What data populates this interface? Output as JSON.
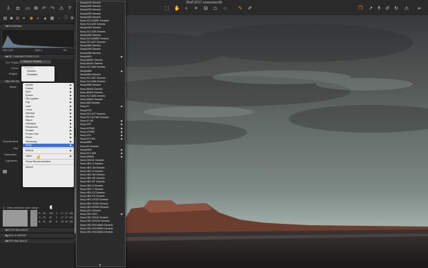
{
  "window": {
    "title": "Bluff 2017.cosessiondb"
  },
  "toolbar": {
    "left_icons": [
      "import-icon",
      "camera-icon",
      "folder-icon",
      "copy-icon",
      "undo-icon",
      "redo-icon",
      "warning-icon",
      "help-icon"
    ],
    "center_icons": [
      "cursor-tool-icon",
      "pan-tool-icon",
      "zoom-tool-icon",
      "crop-tool-icon",
      "straighten-tool-icon",
      "keystone-tool-icon",
      "spot-removal-icon",
      "brush-tool-icon",
      "picker-tool-icon"
    ],
    "right_icons": [
      "layers-icon",
      "copy-apply-icon",
      "reset-icon",
      "rotate-left-icon",
      "rotate-right-icon",
      "compare-icon",
      "glasses-icon"
    ]
  },
  "left_panel": {
    "histogram": {
      "title": "HISTOGRAM",
      "iso": "ISO 100",
      "shutter": "1/60 s",
      "aperture": "f/4"
    },
    "base_characteristics": {
      "title": "BASE CHARACTERISTICS",
      "icc_profile_label": "ICC Profile",
      "icc_profile_value": "Sony A7 Generic",
      "curve_label": "Curve",
      "engine_label": "Engine"
    },
    "section_ex": "COLOR ED",
    "basic_label": "Basic",
    "smoothness_label": "Smoothness",
    "hue_label": "Hue",
    "saturation_label": "Saturation",
    "lightness_label": "Lightness",
    "view_selected_label": "View selected color range",
    "readout": {
      "r_label": "R:",
      "g_label": "G:",
      "b_label": "B:",
      "cols": [
        [
          "95",
          "93",
          "91"
        ],
        [
          "102",
          "99",
          "96"
        ],
        [
          "4",
          "4",
          "5"
        ],
        [
          "17",
          "17",
          "18"
        ],
        [
          "17",
          "17",
          "18"
        ],
        [
          "184",
          "184",
          "184"
        ]
      ]
    },
    "color_balance": "COLOR BALANCE",
    "black_white": "BLACK & WHITE",
    "white_balance": "WHITE BALANCE"
  },
  "curve_menu": {
    "items": [
      {
        "label": "Sony A7",
        "disabled": true
      },
      {
        "label": "Generic",
        "disabled": false
      },
      {
        "label": "Standard",
        "disabled": false
      }
    ]
  },
  "make_menu": {
    "items": [
      "Adobe",
      "Canon",
      "DxO",
      "Epson",
      "File system",
      "Fuji",
      "Leaf",
      "Leica",
      "Mamiya",
      "Minolta",
      "Nikon",
      "Olympus",
      "Panasonic",
      "Pentax",
      "Phase One",
      "Ricoh",
      "Samsung",
      "Sony"
    ],
    "selected": "Sony",
    "footer": [
      "Effects",
      "Other",
      "Show Recommended",
      "Import"
    ]
  },
  "sony_menu": {
    "items": [
      {
        "label": "SonyA100 Generic",
        "sub": false
      },
      {
        "label": "SonyA200 Generic",
        "sub": false
      },
      {
        "label": "SonyA230 Generic",
        "sub": false
      },
      {
        "label": "SonyA290 Generic",
        "sub": false
      },
      {
        "label": "SonyA300 Generic",
        "sub": false
      },
      {
        "label": "Sony SLT-A33SR Generic",
        "sub": false
      },
      {
        "label": "Sony SLT-A33 Generic",
        "sub": false
      },
      {
        "label": "SonyA330 Generic",
        "sub": false
      },
      {
        "label": "Sony SLT-A35 Generic",
        "sub": false
      },
      {
        "label": "SonyA350 Generic",
        "sub": false
      },
      {
        "label": "Sony SLT-A35SR Generic",
        "sub": false
      },
      {
        "label": "Sony SLT-A37 Generic",
        "sub": false
      },
      {
        "label": "SonyA380 Generic",
        "sub": false
      },
      {
        "label": "SonyA390 Generic",
        "sub": false
      },
      {
        "label": "SonyA450 Generic",
        "sub": false
      },
      {
        "label": "SonyA500",
        "sub": true
      },
      {
        "label": "Sony A5000 Generic",
        "sub": false
      },
      {
        "label": "Sony A5100 Generic",
        "sub": false
      },
      {
        "label": "Sony SLT-A55 Generic",
        "sub": false
      },
      {
        "label": "SonyA550",
        "sub": true
      },
      {
        "label": "SonyA560 Generic",
        "sub": false
      },
      {
        "label": "Sony SLT-A57 Generic",
        "sub": false
      },
      {
        "label": "Sony SLT-A58 Generic",
        "sub": false
      },
      {
        "label": "SonyA580 Generic",
        "sub": false
      },
      {
        "label": "Sony A6000 Generic",
        "sub": false
      },
      {
        "label": "Sony A6300 Generic",
        "sub": false
      },
      {
        "label": "Sony SLT-A65 Generic",
        "sub": false
      },
      {
        "label": "Sony A6500 Generic",
        "sub": false
      },
      {
        "label": "Sony A66 Generic",
        "sub": false
      },
      {
        "label": "Sony A7",
        "sub": true
      },
      {
        "label": "SonyA700",
        "sub": false
      },
      {
        "label": "Sony SLT-A77 Generic",
        "sub": false
      },
      {
        "label": "Sony SLT-A77M2 Generic",
        "sub": false
      },
      {
        "label": "Sony A7 M2",
        "sub": true
      },
      {
        "label": "Sony A7R",
        "sub": true
      },
      {
        "label": "Sony A7RM2",
        "sub": true
      },
      {
        "label": "Sony A7RM3",
        "sub": true
      },
      {
        "label": "Sony A7S",
        "sub": true
      },
      {
        "label": "Sony A7S M2",
        "sub": true
      },
      {
        "label": "SonyA850",
        "sub": false
      },
      {
        "label": "Sony A9 Generic",
        "sub": false
      },
      {
        "label": "SonyA900",
        "sub": true
      },
      {
        "label": "Sony SLT-A99",
        "sub": true
      },
      {
        "label": "Sony A99M2",
        "sub": true
      },
      {
        "label": "Sony DSC01 Generic",
        "sub": false
      },
      {
        "label": "Sony NEX-3 Generic",
        "sub": false
      },
      {
        "label": "Sony NEX-3N Generic",
        "sub": false
      },
      {
        "label": "Sony NEX-5 Generic",
        "sub": false
      },
      {
        "label": "Sony NEX-5N Generic",
        "sub": false
      },
      {
        "label": "Sony NEX-5R Generic",
        "sub": false
      },
      {
        "label": "Sony NEX-5T Generic",
        "sub": false
      },
      {
        "label": "Sony NEX-6 Generic",
        "sub": false
      },
      {
        "label": "Sony NEX-7 Generic",
        "sub": false
      },
      {
        "label": "Sony NEX-C3 Generic",
        "sub": false
      },
      {
        "label": "Sony NEX-F3 Generic",
        "sub": false
      },
      {
        "label": "Sony NEX-VG20 Generic",
        "sub": false
      },
      {
        "label": "Sony NEX-VG30 Generic",
        "sub": false
      },
      {
        "label": "Sony NEXVG900 Generic",
        "sub": false
      },
      {
        "label": "Sony QX1 Generic",
        "sub": false
      },
      {
        "label": "Sony DSC-RX1",
        "sub": true
      },
      {
        "label": "Sony DSC-RX10 Generic",
        "sub": false
      },
      {
        "label": "Sony DSC-RX100 Generic",
        "sub": false
      },
      {
        "label": "Sony DSC-RX100M2 Generic",
        "sub": false
      },
      {
        "label": "Sony DSC-RX100M3 Generic",
        "sub": false
      },
      {
        "label": "Sony DSC-RX100M4 Generic",
        "sub": false
      }
    ]
  },
  "colors": {
    "accent": "#e8922c",
    "selection": "#3a72d8"
  }
}
